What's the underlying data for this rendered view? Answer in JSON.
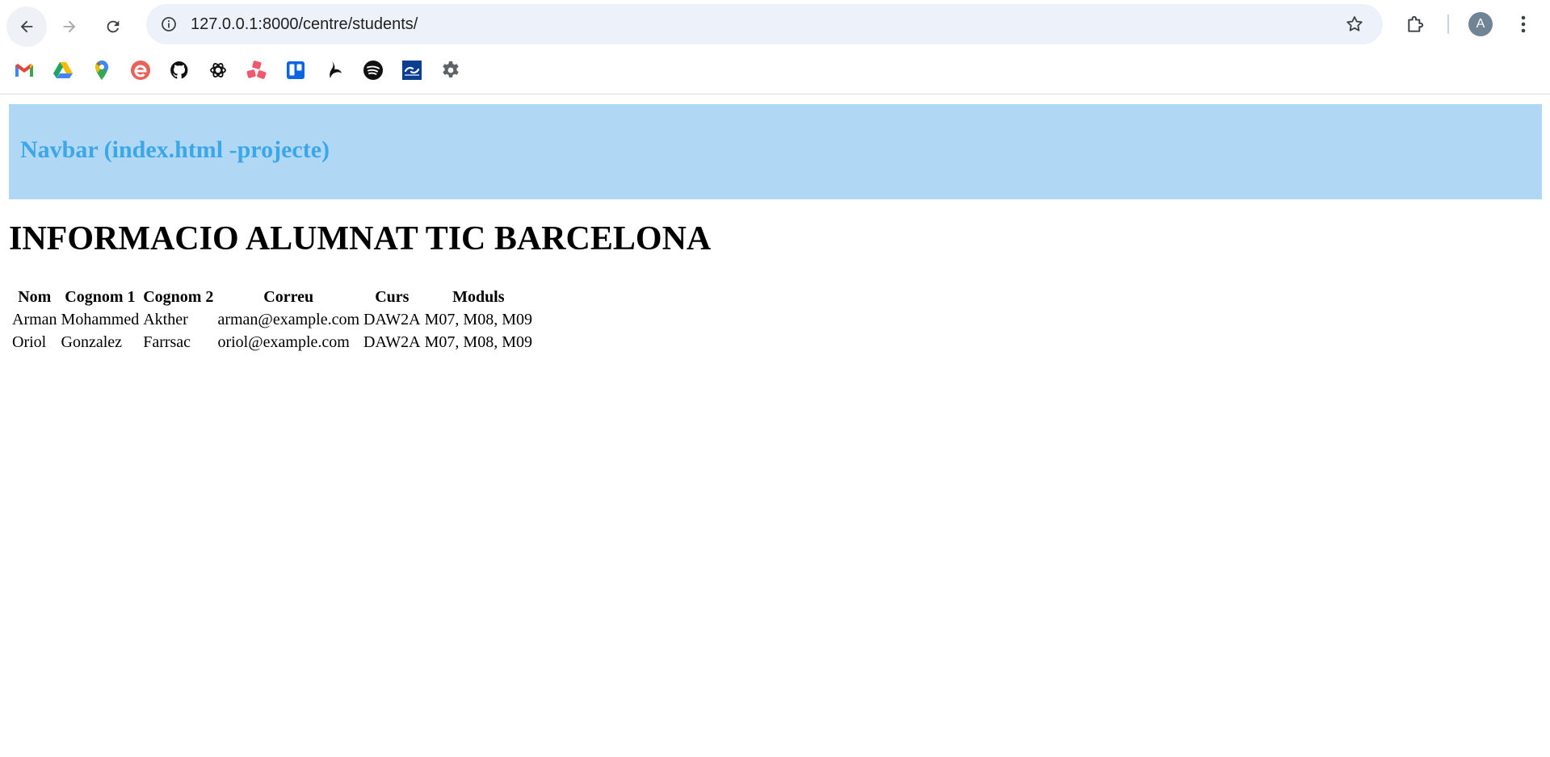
{
  "browser": {
    "url": "127.0.0.1:8000/centre/students/",
    "avatar_letter": "A",
    "bookmarks": [
      {
        "icon": "gmail-icon",
        "color": "#ea4335"
      },
      {
        "icon": "google-drive-icon",
        "color": "#1fa463"
      },
      {
        "icon": "google-maps-icon",
        "color": "#34a853"
      },
      {
        "icon": "e-logo-icon",
        "color": "#e8625a"
      },
      {
        "icon": "github-icon",
        "color": "#111111"
      },
      {
        "icon": "chatgpt-icon",
        "color": "#111111"
      },
      {
        "icon": "asana-icon",
        "color": "#f0586e"
      },
      {
        "icon": "trello-icon",
        "color": "#0c66e4"
      },
      {
        "icon": "bird-logo-icon",
        "color": "#111111"
      },
      {
        "icon": "spotify-icon",
        "color": "#111111"
      },
      {
        "icon": "link-app-icon",
        "color": "#0b3d91"
      },
      {
        "icon": "settings-gear-icon",
        "color": "#5f6368"
      }
    ]
  },
  "navbar": {
    "title": "Navbar (index.html -projecte)",
    "background": "#b0d8f4",
    "text_color": "#3ba6e8"
  },
  "page": {
    "title": "INFORMACIO ALUMNAT TIC BARCELONA"
  },
  "students_table": {
    "headers": [
      "Nom",
      "Cognom 1",
      "Cognom 2",
      "Correu",
      "Curs",
      "Moduls"
    ],
    "rows": [
      [
        "Arman",
        "Mohammed",
        "Akther",
        "arman@example.com",
        "DAW2A",
        "M07, M08, M09"
      ],
      [
        "Oriol",
        "Gonzalez",
        "Farrsac",
        "oriol@example.com",
        "DAW2A",
        "M07, M08, M09"
      ]
    ]
  }
}
